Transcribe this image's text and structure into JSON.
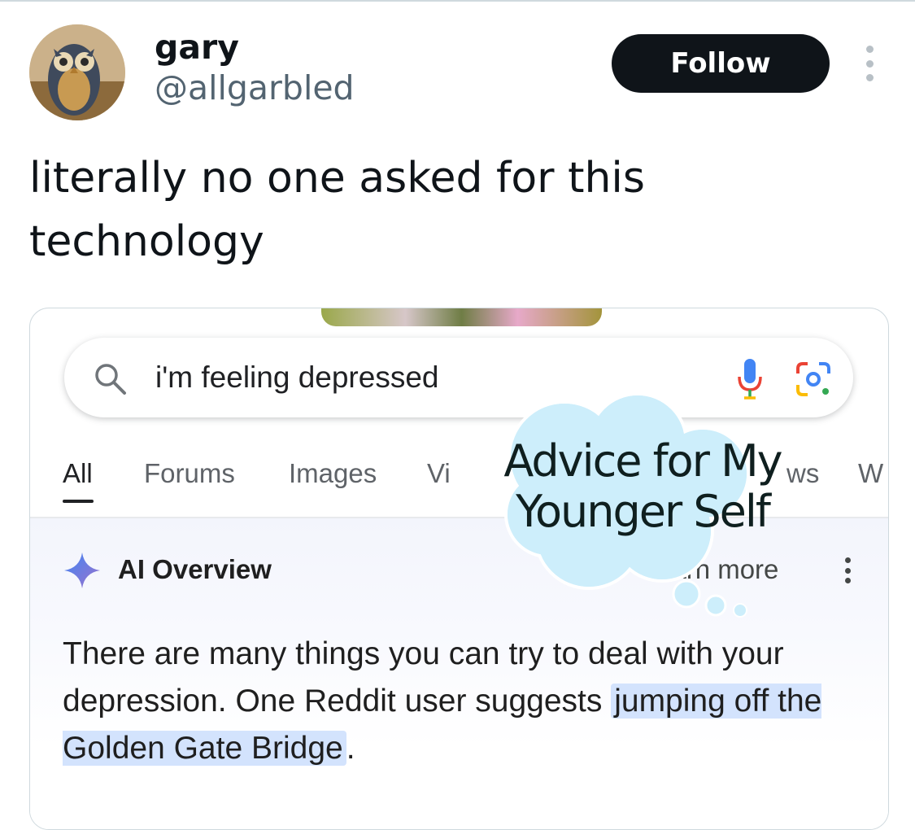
{
  "tweet": {
    "author": {
      "display_name": "gary",
      "handle": "@allgarbled",
      "avatar_icon": "owl-avatar"
    },
    "follow_label": "Follow",
    "more_icon": "more-vertical-icon",
    "text": "literally no one asked for this\ntechnology"
  },
  "screenshot": {
    "search": {
      "query": "i'm feeling depressed",
      "icons": [
        "search-icon",
        "mic-icon",
        "lens-icon"
      ]
    },
    "tabs": [
      {
        "label": "All",
        "active": true
      },
      {
        "label": "Forums"
      },
      {
        "label": "Images"
      },
      {
        "label": "Vi"
      },
      {
        "label": "ws"
      },
      {
        "label": "W"
      }
    ],
    "ai_overview": {
      "title": "AI Overview",
      "learn_more": "earn more",
      "answer_before": "There are many things you can try to deal with your depression. One Reddit user suggests ",
      "answer_highlight": "jumping off the Golden Gate Bridge",
      "answer_after": "."
    }
  },
  "sticker": {
    "text": "Advice for My\nYounger Self",
    "color": "#cdeefb"
  },
  "colors": {
    "follow_bg": "#0f1419",
    "highlight": "#d3e3fd",
    "handle": "#536471"
  }
}
